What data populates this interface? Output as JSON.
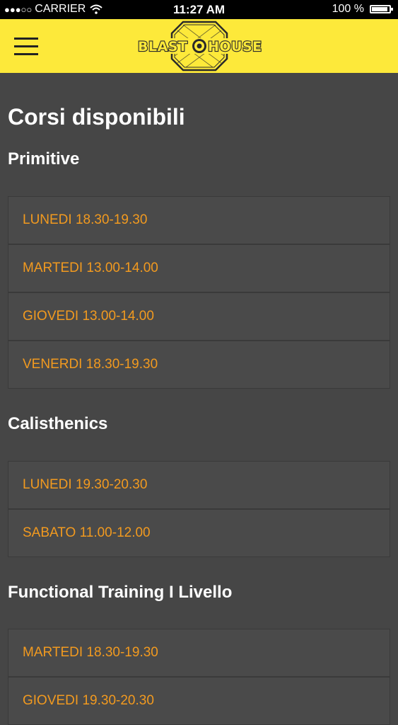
{
  "status_bar": {
    "signal": "●●●○○",
    "carrier": "CARRIER",
    "time": "11:27 AM",
    "battery": "100 %",
    "battery_level": 1.0
  },
  "header": {
    "logo_text_left": "BLAST",
    "logo_text_right": "HOUSE"
  },
  "page_title": "Corsi disponibili",
  "sections": [
    {
      "title": "Primitive",
      "slots": [
        "LUNEDI 18.30-19.30",
        "MARTEDI 13.00-14.00",
        "GIOVEDI 13.00-14.00",
        "VENERDI 18.30-19.30"
      ]
    },
    {
      "title": "Calisthenics",
      "slots": [
        "LUNEDI 19.30-20.30",
        "SABATO 11.00-12.00"
      ]
    },
    {
      "title": "Functional Training I Livello",
      "slots": [
        "MARTEDI 18.30-19.30",
        "GIOVEDI 19.30-20.30"
      ]
    }
  ],
  "colors": {
    "header_bg": "#fde93a",
    "page_bg": "#464646",
    "slot_text": "#f29a1f"
  }
}
